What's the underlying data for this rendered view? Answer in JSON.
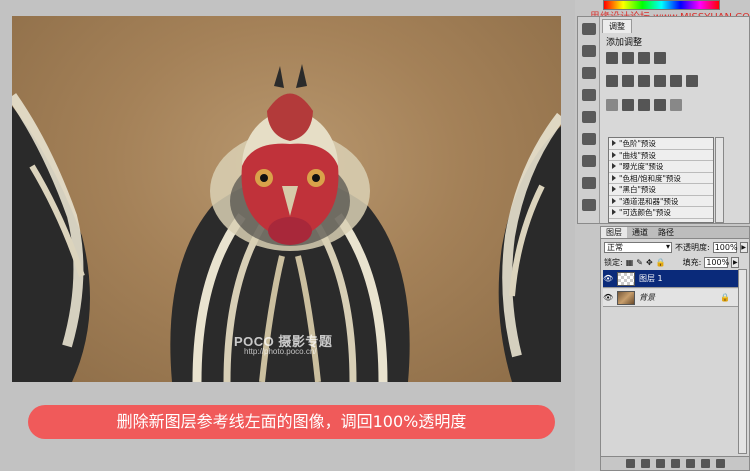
{
  "site": {
    "text": "思缘设计论坛 www.MISSYUAN.COM"
  },
  "photo": {
    "watermark": "POCO 摄影专题",
    "watermark_url": "http://photo.poco.cn/"
  },
  "caption": {
    "text": "删除新图层参考线左面的图像，调回100%透明度"
  },
  "adjustments": {
    "tab_label": "调整",
    "title": "添加调整",
    "presets": [
      "\"色阶\"预设",
      "\"曲线\"预设",
      "\"曝光度\"预设",
      "\"色相/饱和度\"预设",
      "\"黑白\"预设",
      "\"通道混和器\"预设",
      "\"可选颜色\"预设"
    ]
  },
  "layers": {
    "tabs": [
      "图层",
      "通道",
      "路径"
    ],
    "blend_mode": "正常",
    "opacity_label": "不透明度:",
    "opacity_value": "100%",
    "lock_label": "锁定:",
    "fill_label": "填充:",
    "fill_value": "100%",
    "items": [
      {
        "name": "图层 1",
        "selected": true
      },
      {
        "name": "背景",
        "selected": false,
        "locked": true
      }
    ]
  },
  "colors": {
    "caption_bg": "#f05a5a",
    "selected_layer": "#0a2a7a",
    "site_text": "#d9302c"
  }
}
